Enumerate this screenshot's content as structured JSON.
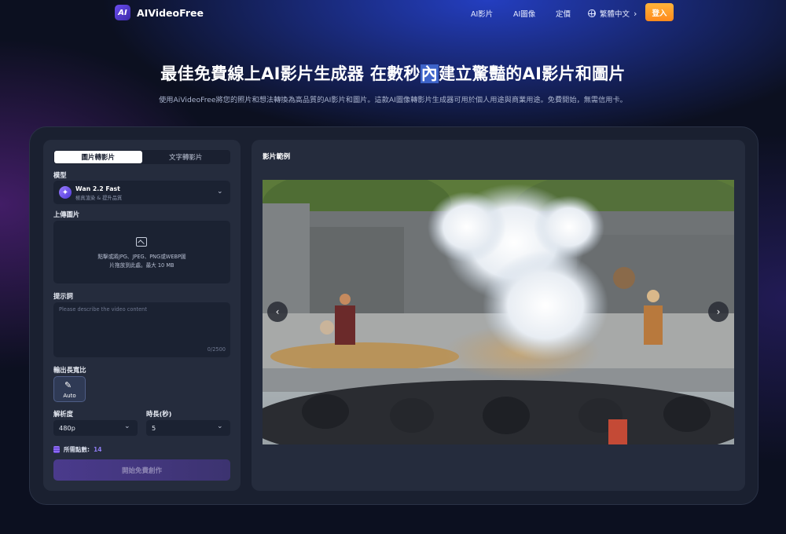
{
  "header": {
    "logo_badge": "AI",
    "logo_text": "AIVideoFree",
    "nav": {
      "ai_video": "AI影片",
      "ai_image": "AI圖像",
      "pricing": "定價",
      "language": "繁體中文"
    },
    "login": "登入"
  },
  "hero": {
    "title_before": "最佳免費線上AI影片生成器 在數秒",
    "title_highlight": "內",
    "title_after": "建立驚豔的AI影片和圖片",
    "subtitle": "使用AiVideoFree將您的照片和想法轉換為高品質的AI影片和圖片。這款AI圖像轉影片生成器可用於個人用途與商業用途。免費開始，無需信用卡。"
  },
  "form": {
    "tabs": [
      "圖片轉影片",
      "文字轉影片"
    ],
    "active_tab": 0,
    "model_label": "模型",
    "model": {
      "name": "Wan 2.2 Fast",
      "desc": "極真渲染 & 提升品質"
    },
    "upload_label": "上傳圖片",
    "upload_text_1": "點擊或將JPG、JPEG、PNG或WEBP圖",
    "upload_text_2": "片拖放到此處。最大 10 MB",
    "prompt_label": "提示詞",
    "prompt_placeholder": "Please describe the video content",
    "prompt_count": "0/2500",
    "ratio_label": "輸出長寬比",
    "ratio_value": "Auto",
    "resolution_label": "解析度",
    "resolution_value": "480p",
    "duration_label": "時長(秒)",
    "duration_value": "5",
    "points_label": "所需點數:",
    "points_value": "14",
    "start_button": "開始免費創作"
  },
  "examples": {
    "title": "影片範例",
    "prev": "‹",
    "next": "›"
  },
  "colors": {
    "accent_orange": "#ff9a2a",
    "accent_purple": "#6b4cf0",
    "panel": "#252c3d",
    "card": "#1a2030"
  }
}
